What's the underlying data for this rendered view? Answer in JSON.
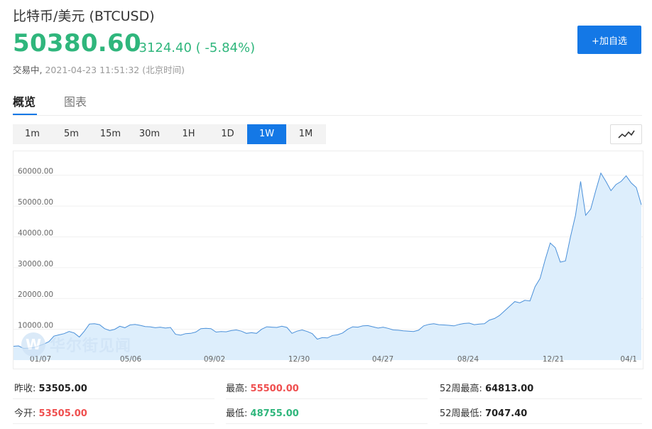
{
  "header": {
    "title": "比特币/美元  (BTCUSD)",
    "price": "50380.60",
    "change": "-3124.40 ( -5.84%)",
    "status": "交易中,",
    "timestamp": "2021-04-23 11:51:32 (北京时间)",
    "add_button": "+加自选"
  },
  "tabs": [
    {
      "label": "概览",
      "active": true
    },
    {
      "label": "图表",
      "active": false
    }
  ],
  "ranges": [
    {
      "label": "1m",
      "active": false
    },
    {
      "label": "5m",
      "active": false
    },
    {
      "label": "15m",
      "active": false
    },
    {
      "label": "30m",
      "active": false
    },
    {
      "label": "1H",
      "active": false
    },
    {
      "label": "1D",
      "active": false
    },
    {
      "label": "1W",
      "active": true
    },
    {
      "label": "1M",
      "active": false
    }
  ],
  "chart_type_icon": "line-chart-icon",
  "watermark": {
    "logo": "W",
    "text": "华尔街见闻"
  },
  "chart_data": {
    "type": "area",
    "title": "",
    "xlabel": "",
    "ylabel": "",
    "ylim": [
      0,
      65000
    ],
    "y_ticks": [
      "0.00",
      "10000.00",
      "20000.00",
      "30000.00",
      "40000.00",
      "50000.00",
      "60000.00"
    ],
    "x_ticks": [
      "01/07",
      "05/06",
      "09/02",
      "12/30",
      "04/27",
      "08/24",
      "12/21",
      "04/1"
    ],
    "grid": true,
    "line_color": "#4a90d9",
    "fill_color": "#ddeefc",
    "values": [
      4500,
      4600,
      3800,
      3900,
      4100,
      4600,
      5200,
      6000,
      7800,
      8200,
      8600,
      9300,
      8800,
      7500,
      9400,
      11700,
      11800,
      11500,
      10200,
      9600,
      10000,
      11000,
      10500,
      11400,
      11600,
      11300,
      10900,
      10800,
      10500,
      10700,
      10400,
      10600,
      8400,
      8100,
      8600,
      8700,
      9100,
      10200,
      10300,
      10200,
      9100,
      9300,
      9200,
      9600,
      9800,
      9400,
      8700,
      8900,
      8700,
      10000,
      10800,
      10700,
      10600,
      11000,
      10600,
      8700,
      9400,
      9800,
      9300,
      8600,
      6800,
      7300,
      7200,
      8000,
      8200,
      8800,
      10000,
      10800,
      10700,
      11100,
      11200,
      10800,
      10400,
      10700,
      10300,
      9800,
      9700,
      9500,
      9400,
      9300,
      9700,
      11100,
      11600,
      11800,
      11500,
      11400,
      11300,
      11100,
      11600,
      11900,
      12000,
      11500,
      11700,
      11800,
      13000,
      13500,
      14500,
      16000,
      17500,
      19000,
      18600,
      19400,
      19200,
      23800,
      26500,
      32500,
      38000,
      36500,
      31800,
      32200,
      40000,
      47000,
      58000,
      47000,
      49000,
      55000,
      60700,
      58000,
      55000,
      57000,
      58000,
      59800,
      57500,
      56000,
      50380
    ]
  },
  "stats": [
    {
      "label": "昨收:",
      "value": "53505.00",
      "color": "dark"
    },
    {
      "label": "最高:",
      "value": "55500.00",
      "color": "red"
    },
    {
      "label": "52周最高:",
      "value": "64813.00",
      "color": "dark"
    },
    {
      "label": "今开:",
      "value": "53505.00",
      "color": "red"
    },
    {
      "label": "最低:",
      "value": "48755.00",
      "color": "green"
    },
    {
      "label": "52周最低:",
      "value": "7047.40",
      "color": "dark"
    }
  ]
}
